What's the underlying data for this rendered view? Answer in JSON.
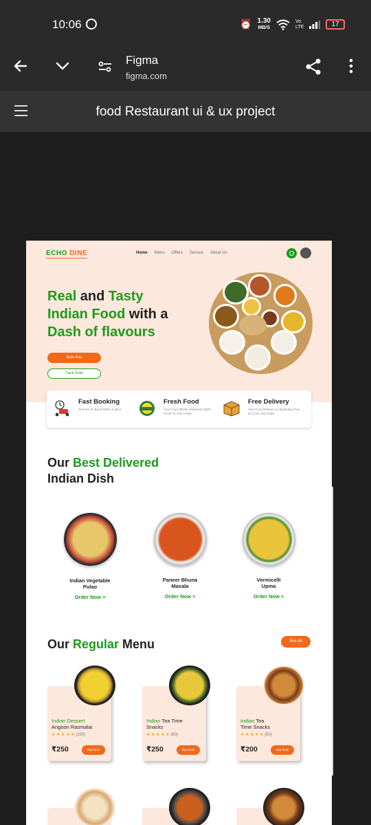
{
  "status_bar": {
    "time": "10:06",
    "speed": "1.30",
    "speed_unit": "MB/S",
    "network": "Vo LTE",
    "battery": "17"
  },
  "browser": {
    "title": "Figma",
    "url": "figma.com"
  },
  "document": {
    "name": "food Restaurant ui & ux project"
  },
  "site": {
    "logo_part1": "ECHO",
    "logo_part2": "DINE",
    "nav": [
      "Home",
      "Menu",
      "Offers",
      "Service",
      "About Us"
    ],
    "hero": {
      "line1_g1": "Real",
      "line1_b": " and ",
      "line1_g2": "Tasty",
      "line2_g": "Indian Food",
      "line2_b": " with a",
      "line3_g": "Dash of flavours",
      "book_btn": "Book Now",
      "track_btn": "Track Order"
    },
    "features": [
      {
        "title": "Fast Booking",
        "desc": "Promise To Book Within 5 Mins",
        "icon": "scooter-clock-icon"
      },
      {
        "title": "Fresh Food",
        "desc": "Your Food Will Be Delivered 100% Fresh To Your Home",
        "icon": "fresh-badge-icon"
      },
      {
        "title": "Free Delivery",
        "desc": "Your Food Delivery Is Absolutely Free. No Cost Just Order",
        "icon": "box-icon"
      }
    ],
    "best": {
      "title_a": "Our ",
      "title_g": "Best Delivered",
      "title_b": "Indian Dish",
      "dishes": [
        {
          "name1": "Indian Vegetable",
          "name2": "Pulao",
          "cta": "Order Now >"
        },
        {
          "name1": "Paneer Bhuna",
          "name2": "Masala",
          "cta": "Order Now >"
        },
        {
          "name1": "Vermicelli",
          "name2": "Upma",
          "cta": "Order Now >"
        }
      ]
    },
    "regular": {
      "title_a": "Our ",
      "title_g": "Regular",
      "title_b": " Menu",
      "see_all": "See All",
      "items": [
        {
          "cat": "Indian Dessert",
          "name": "Angoori Rasmalai",
          "stars": "★ ★ ★ ★ ★",
          "count": "(100)",
          "price": "₹250",
          "buy": "Buy Now"
        },
        {
          "cat_g": "Indian",
          "cat_rest": " Tea Time",
          "name": "Snacks",
          "stars": "★ ★ ★ ★ ★",
          "count": "(80)",
          "price": "₹250",
          "buy": "Buy Now"
        },
        {
          "cat_g": "Indian",
          "cat_rest": " Tea",
          "name": "Time Snacks",
          "stars": "★ ★ ★ ★ ★",
          "count": "(50)",
          "price": "₹200",
          "buy": "Buy Now"
        }
      ]
    }
  },
  "colors": {
    "green": "#1a9b1a",
    "orange": "#f06a1b",
    "peach": "#fde8dd"
  }
}
